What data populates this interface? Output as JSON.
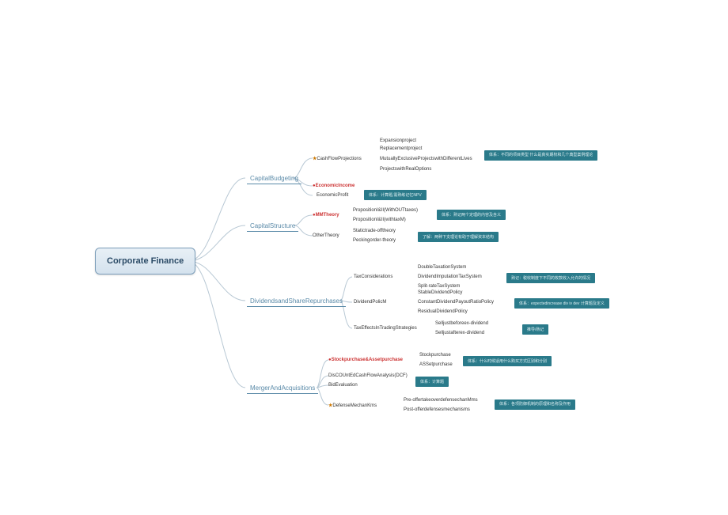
{
  "root": "Corporate Finance",
  "branches": {
    "cb": {
      "label": "CapitalBudgeting",
      "children": {
        "cfp": {
          "label": "CashFlowProjections",
          "star": true,
          "items": [
            "Expansionproject",
            "Replacementproject",
            "MutuallyExclusiveProjectswithDifferentLives",
            "ProjectswithRealOptions"
          ],
          "note": "体系：不同的项目类型\n什么是真实期权和几个典型案例理论"
        },
        "ei": {
          "label": "EconomicIncome",
          "red": true
        },
        "ep": {
          "label": "EconomicProfit",
          "note": "体系：计算题,需熟练记忆NPV"
        }
      }
    },
    "cs": {
      "label": "CapitalStructure",
      "children": {
        "mm": {
          "label": "MMTheory",
          "red": true,
          "items": [
            "PropositionI&II(WithOUTtaxes)",
            "PropositionI&II(withtaxM)"
          ],
          "note": "体系：熟记两个定理的内容及含义"
        },
        "ot": {
          "label": "OtherTheory",
          "items": [
            "Statictrade-offtheory",
            "Peckingorder-theory"
          ],
          "note": "了解：两种下支理论有助于理解资本结构"
        }
      }
    },
    "dsr": {
      "label": "DividendsandShareRepurchases",
      "children": {
        "tc": {
          "label": "TaxConsiderations",
          "items": [
            "DoubleTaxationSystem",
            "DividendImputationTaxSystem",
            "Split-rateTaxSystem"
          ],
          "note": "熟记：税收制度下不同的枚款收入允许的情况"
        },
        "dp": {
          "label": "DividendPolicM",
          "items": [
            "StableDividendPolicy",
            "ConstantDividendPayoutRatioPolicy",
            "ResidualDividendPolicy"
          ],
          "note": "体系：expectedincrease div iv dev 计算题及定义"
        },
        "tets": {
          "label": "TaxEffectsInTradingStrategies",
          "items": [
            "Selljustbeforeex-dividend",
            "Selljustafterex-dividend"
          ],
          "note2": "推导/熟记"
        }
      }
    },
    "ma": {
      "label": "MergerAndAcquisitions",
      "children": {
        "sp": {
          "label": "Stockpurchase&Assetpurchase",
          "red": true,
          "items": [
            "Stockpurchase",
            "ASSetpurchase"
          ],
          "note": "体系：什么时候适用什么购买方式区别和分别"
        },
        "dcf": {
          "label": "DisCOUntEdCashFlowAnalysis(DCF)"
        },
        "be": {
          "label": "BidEvaluation",
          "note": "体系：计算题"
        },
        "dm": {
          "label": "DefenseMechanKms",
          "star": true,
          "items": [
            "Pre-offertakeoverdefensechanMms",
            "Post-offerdefensesmechanisms"
          ],
          "note": "体系：各项防御机制的原理和名称及作用"
        }
      }
    }
  }
}
